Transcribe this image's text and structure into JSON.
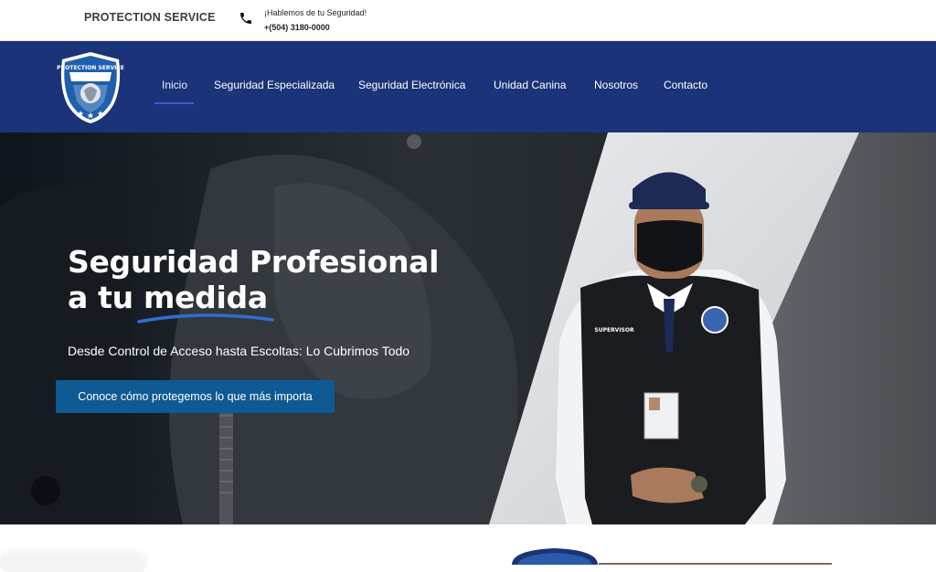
{
  "topbar": {
    "brand": "PROTECTION SERVICE",
    "contact_prompt": "¡Hablemos de tu Seguridad!",
    "phone": "+(504) 3180-0000",
    "phone_icon": "phone-icon"
  },
  "nav": {
    "logo_text": "PROTECTION SERVICE",
    "items": [
      {
        "label": "Inicio",
        "active": true
      },
      {
        "label": "Seguridad Especializada"
      },
      {
        "label": "Seguridad Electrónica"
      },
      {
        "label": "Unidad Canina"
      },
      {
        "label": "Nosotros"
      },
      {
        "label": "Contacto"
      }
    ]
  },
  "hero": {
    "title_line1": "Seguridad Profesional",
    "title_line2_a": "a tu ",
    "title_line2_b": "medida",
    "subtitle": "Desde Control de Acceso hasta Escoltas: Lo Cubrimos Todo",
    "cta": "Conoce cómo protegemos lo que más importa",
    "badge_text": "SUPERVISOR"
  },
  "colors": {
    "nav_bg": "#1b3378",
    "cta_bg": "#0f5a93",
    "swoosh": "#2e6fd1"
  }
}
